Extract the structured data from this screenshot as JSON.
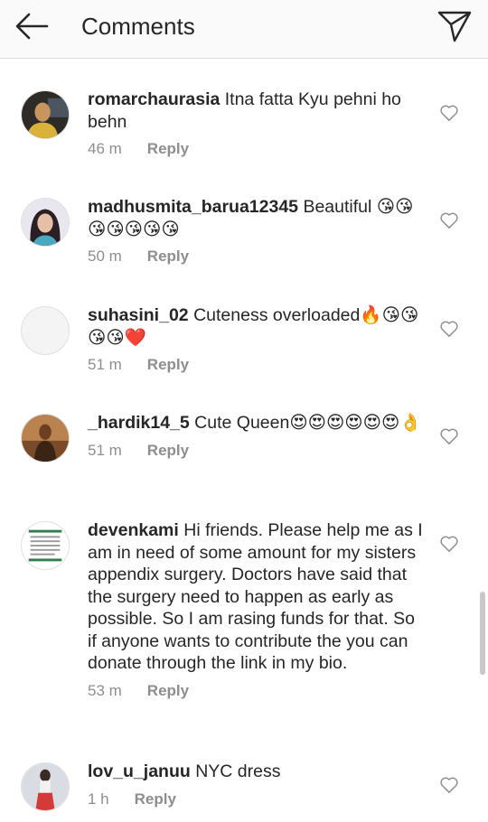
{
  "header": {
    "title": "Comments",
    "back_icon": "back-arrow-icon",
    "send_icon": "direct-send-icon"
  },
  "comments": [
    {
      "username": "romarchaurasia",
      "text": "Itna fatta Kyu pehni ho behn",
      "time": "46 m",
      "reply": "Reply"
    },
    {
      "username": "madhusmita_barua12345",
      "text": "Beautiful 😘😘😘😘😘😘😘",
      "time": "50 m",
      "reply": "Reply"
    },
    {
      "username": "suhasini_02",
      "text": "Cuteness overloaded🔥😘😘😘😘❤️",
      "time": "51 m",
      "reply": "Reply"
    },
    {
      "username": "_hardik14_5",
      "text": "Cute Queen😍😍😍😍😍😍👌",
      "time": "51 m",
      "reply": "Reply"
    },
    {
      "username": "devenkami",
      "text": "Hi friends. Please help me as I am in need of some amount for my sisters appendix surgery. Doctors have said that the surgery need to happen as early as possible. So I am rasing funds for that. So if anyone wants to contribute the you can donate through the link in my bio.",
      "time": "53 m",
      "reply": "Reply"
    },
    {
      "username": "lov_u_januu",
      "text": "NYC dress",
      "time": "1 h",
      "reply": "Reply"
    }
  ],
  "colors": {
    "text": "#262626",
    "meta": "#8e8e8e",
    "divider": "#dbdbdb",
    "header_bg": "#fafafa"
  }
}
